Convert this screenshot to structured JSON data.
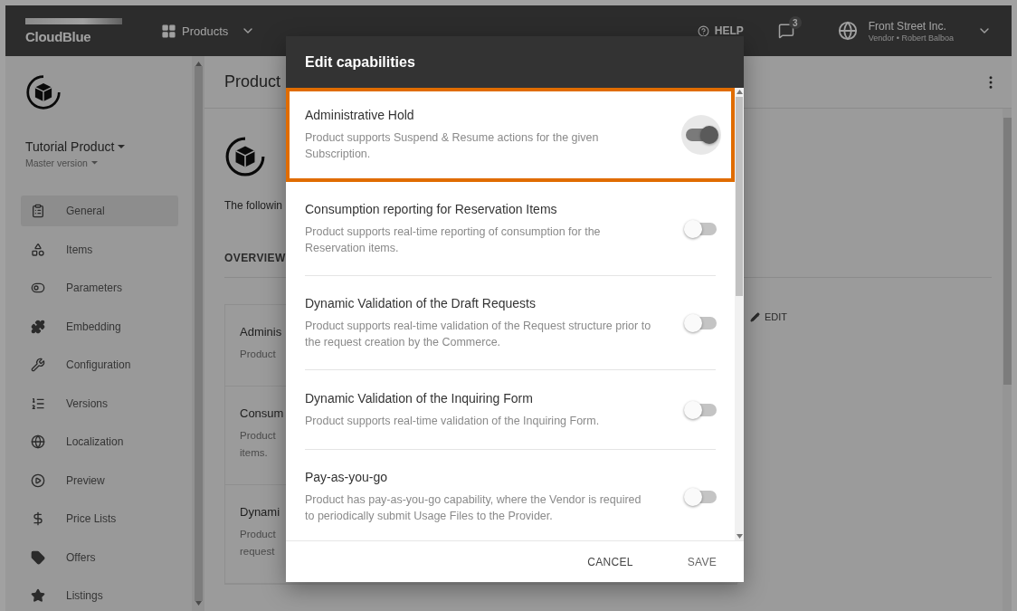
{
  "top_bar": {
    "logo": "CloudBlue",
    "menu": "Products",
    "help": "HELP",
    "notification_count": "3",
    "account": {
      "name": "Front Street Inc.",
      "role": "Vendor • Robert Balboa"
    }
  },
  "sidebar": {
    "product_name": "Tutorial Product",
    "version": "Master version",
    "items": [
      {
        "label": "General",
        "selected": true
      },
      {
        "label": "Items",
        "selected": false
      },
      {
        "label": "Parameters",
        "selected": false
      },
      {
        "label": "Embedding",
        "selected": false
      },
      {
        "label": "Configuration",
        "selected": false
      },
      {
        "label": "Versions",
        "selected": false
      },
      {
        "label": "Localization",
        "selected": false
      },
      {
        "label": "Preview",
        "selected": false
      },
      {
        "label": "Price Lists",
        "selected": false
      },
      {
        "label": "Offers",
        "selected": false
      },
      {
        "label": "Listings",
        "selected": false
      }
    ]
  },
  "page": {
    "title": "Product",
    "intro": "The followin",
    "tab": "OVERVIEW",
    "edit": "EDIT",
    "capabilities": [
      {
        "title": "Adminis",
        "description": [
          "Product"
        ]
      },
      {
        "title": "Consum",
        "description": [
          "Product",
          "items."
        ]
      },
      {
        "title": "Dynami",
        "description": [
          "Product",
          "request"
        ]
      }
    ]
  },
  "dialog": {
    "title": "Edit capabilities",
    "items": [
      {
        "title": "Administrative Hold",
        "description": "Product supports Suspend & Resume actions for the given Subscription.",
        "on": true,
        "focused": true,
        "highlighted": true
      },
      {
        "title": "Consumption reporting for Reservation Items",
        "description": "Product supports real-time reporting of consumption for the Reservation items.",
        "on": false,
        "focused": false,
        "highlighted": false
      },
      {
        "title": "Dynamic Validation of the Draft Requests",
        "description": "Product supports real-time validation of the Request structure prior to the request creation by the Commerce.",
        "on": false,
        "focused": false,
        "highlighted": false
      },
      {
        "title": "Dynamic Validation of the Inquiring Form",
        "description": "Product supports real-time validation of the Inquiring Form.",
        "on": false,
        "focused": false,
        "highlighted": false
      },
      {
        "title": "Pay-as-you-go",
        "description": "Product has pay-as-you-go capability, where the Vendor is required to periodically submit Usage Files to the Provider.",
        "on": false,
        "focused": false,
        "highlighted": false
      }
    ],
    "buttons": [
      "CANCEL",
      "SAVE"
    ]
  }
}
